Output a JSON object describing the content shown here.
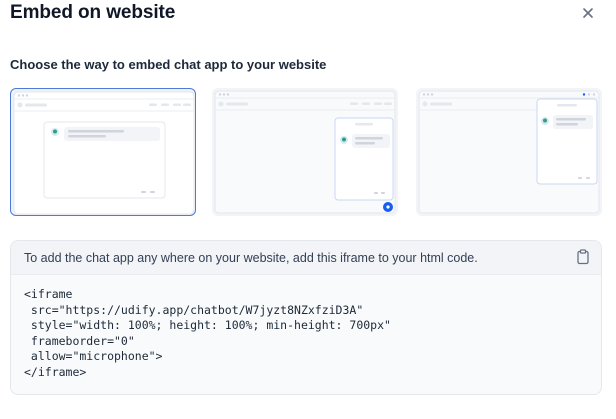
{
  "dialog": {
    "title": "Embed on website",
    "subtitle": "Choose the way to embed chat app to your website"
  },
  "icons": {
    "close": "close-icon",
    "copy": "clipboard-icon"
  },
  "options": [
    {
      "name": "fullscreen-embed",
      "selected": true
    },
    {
      "name": "chat-bubble-embed",
      "selected": false
    },
    {
      "name": "chrome-extension-embed",
      "selected": false
    }
  ],
  "embed": {
    "instruction": "To add the chat app any where on your website, add this iframe to your html code.",
    "code_lines": [
      "<iframe",
      " src=\"https://udify.app/chatbot/W7jyzt8NZxfziD3A\"",
      " style=\"width: 100%; height: 100%; min-height: 700px\"",
      " frameborder=\"0\"",
      " allow=\"microphone\">",
      "</iframe>"
    ]
  },
  "colors": {
    "accent": "#155eef",
    "selected_border": "#4b7bd8"
  }
}
